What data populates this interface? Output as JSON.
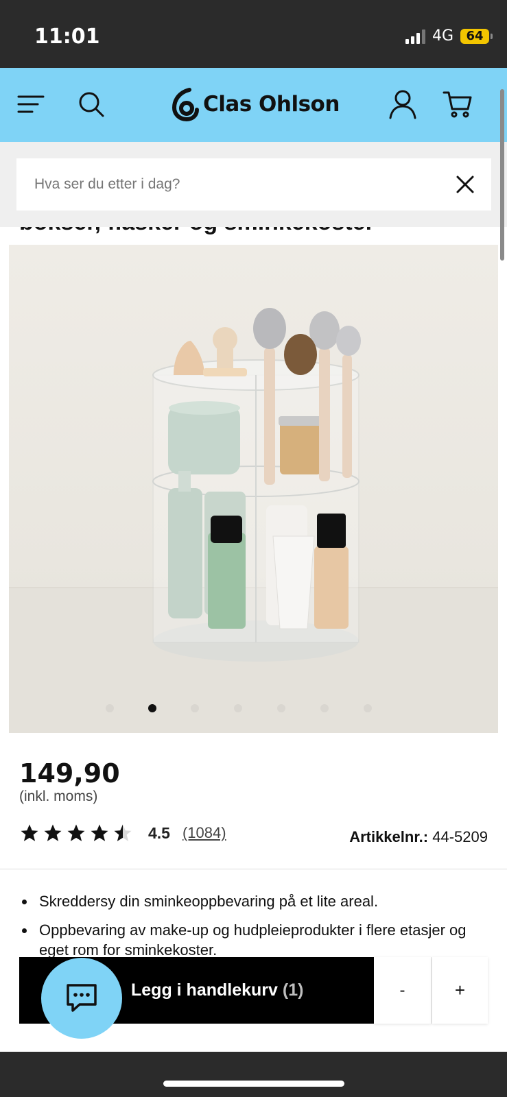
{
  "status_bar": {
    "time": "11:01",
    "network": "4G",
    "battery": "64"
  },
  "header": {
    "brand": "Clas Ohlson",
    "icons": [
      "menu-icon",
      "search-icon",
      "account-icon",
      "cart-icon"
    ]
  },
  "search": {
    "placeholder": "Hva ser du etter i dag?",
    "value": ""
  },
  "product": {
    "title_fragment": "bokser, flasker og sminkekoster",
    "price": "149,90",
    "price_note": "(inkl. moms)",
    "rating": "4.5",
    "rating_fraction": 0.9,
    "review_count": "(1084)",
    "article_label": "Artikkelnr.:",
    "article_number": "44-5209",
    "bullets": [
      "Skreddersy din sminkeoppbevaring på et lite areal.",
      "Oppbevaring av make-up og hudpleieprodukter i flere etasjer og eget rom for sminkekoster."
    ]
  },
  "carousel": {
    "total": 7,
    "active": 1
  },
  "cart": {
    "label": "Legg i handlekurv",
    "count": "(1)",
    "minus": "-",
    "plus": "+"
  },
  "colors": {
    "header_bg": "#7fd3f6",
    "cart_bg": "#000000",
    "status_bg": "#2b2b2b"
  }
}
